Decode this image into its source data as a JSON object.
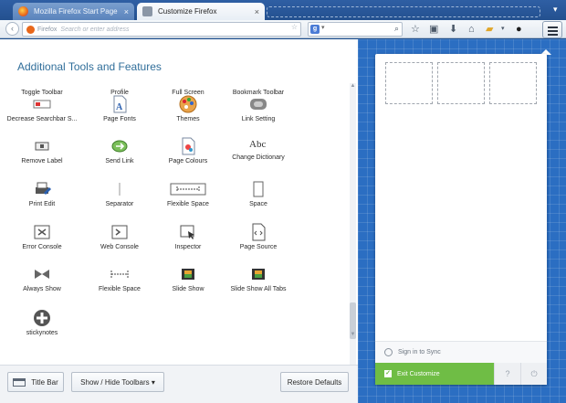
{
  "tabs": [
    {
      "label": "Mozilla Firefox Start Page",
      "close": "×"
    },
    {
      "label": "Customize Firefox",
      "close": "×"
    }
  ],
  "navbar": {
    "back": "‹",
    "identity": "Firefox",
    "url_placeholder": "Search or enter address",
    "bookmark_star": "☆",
    "search_engine": "g",
    "search_dropdown": "▾",
    "search_go": "⌕"
  },
  "palette": {
    "title": "Additional Tools and Features",
    "items": [
      {
        "name": "toggle-toolbar",
        "label": "Toggle Toolbar",
        "icon": "toggle-toolbar-icon"
      },
      {
        "name": "profile",
        "label": "Profile",
        "icon": "profile-icon"
      },
      {
        "name": "full-screen",
        "label": "Full Screen",
        "icon": "full-screen-icon"
      },
      {
        "name": "bookmark-toolbar",
        "label": "Bookmark Toolbar",
        "icon": "bookmark-toolbar-icon"
      },
      {
        "name": "decrease-searchbar",
        "label": "Decrease Searchbar S...",
        "icon": "decrease-searchbar-icon"
      },
      {
        "name": "page-fonts",
        "label": "Page Fonts",
        "icon": "page-fonts-icon"
      },
      {
        "name": "themes",
        "label": "Themes",
        "icon": "themes-palette-icon"
      },
      {
        "name": "link-setting",
        "label": "Link Setting",
        "icon": "link-setting-icon"
      },
      {
        "name": "remove-label",
        "label": "Remove Label",
        "icon": "remove-label-icon"
      },
      {
        "name": "send-link",
        "label": "Send Link",
        "icon": "send-link-icon"
      },
      {
        "name": "page-colours",
        "label": "Page Colours",
        "icon": "page-colours-icon"
      },
      {
        "name": "change-dictionary",
        "label": "Change Dictionary",
        "icon": "dictionary-icon"
      },
      {
        "name": "print-edit",
        "label": "Print Edit",
        "icon": "print-edit-icon"
      },
      {
        "name": "separator",
        "label": "Separator",
        "icon": "separator-icon"
      },
      {
        "name": "flexible-space",
        "label": "Flexible Space",
        "icon": "flexible-space-icon"
      },
      {
        "name": "space",
        "label": "Space",
        "icon": "space-icon"
      },
      {
        "name": "error-console",
        "label": "Error Console",
        "icon": "error-console-icon"
      },
      {
        "name": "web-console",
        "label": "Web Console",
        "icon": "web-console-icon"
      },
      {
        "name": "inspector",
        "label": "Inspector",
        "icon": "inspector-icon"
      },
      {
        "name": "page-source",
        "label": "Page Source",
        "icon": "page-source-icon"
      },
      {
        "name": "always-show",
        "label": "Always Show",
        "icon": "always-show-icon"
      },
      {
        "name": "flexible-space-2",
        "label": "Flexible Space",
        "icon": "flexible-space-small-icon"
      },
      {
        "name": "slide-show",
        "label": "Slide Show",
        "icon": "slide-show-icon"
      },
      {
        "name": "slide-show-all-tabs",
        "label": "Slide Show All Tabs",
        "icon": "slide-show-all-icon"
      },
      {
        "name": "stickynotes",
        "label": "stickynotes",
        "icon": "stickynotes-icon"
      }
    ]
  },
  "footer": {
    "title_bar": "Title Bar",
    "show_hide_toolbars": "Show / Hide Toolbars ▾",
    "restore_defaults": "Restore Defaults"
  },
  "menu_panel": {
    "sign_in_sync": "Sign in to Sync",
    "exit_customize": "Exit Customize",
    "help": "?",
    "quit": "⏻"
  },
  "colors": {
    "accent_green": "#6fbd45",
    "blueprint": "#2b6ec2",
    "title_blue": "#306e9a"
  }
}
